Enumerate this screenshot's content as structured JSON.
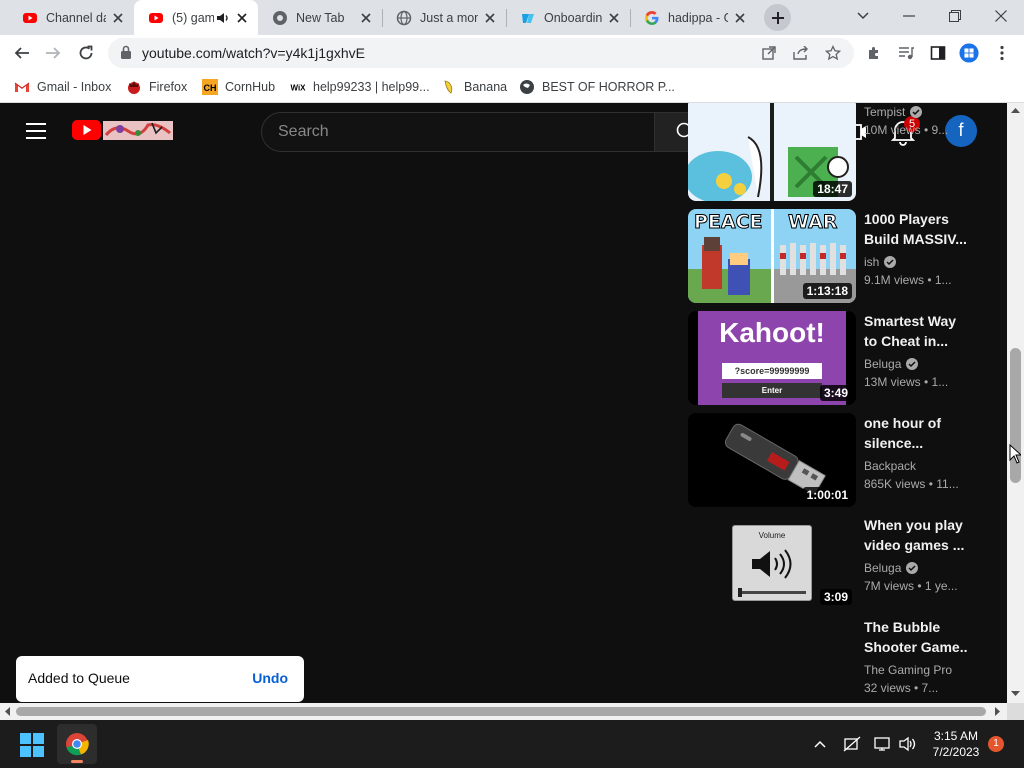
{
  "browser": {
    "tabs": [
      {
        "title": "Channel da",
        "favicon": "youtube-icon"
      },
      {
        "title": "(5) gam",
        "favicon": "youtube-icon",
        "active": true,
        "audio": true
      },
      {
        "title": "New Tab",
        "favicon": "chrome-icon"
      },
      {
        "title": "Just a mom",
        "favicon": "globe-icon"
      },
      {
        "title": "Onboardin",
        "favicon": "onboarding-icon"
      },
      {
        "title": "hadippa - G",
        "favicon": "google-icon"
      }
    ],
    "url": "youtube.com/watch?v=y4k1j1gxhvE"
  },
  "bookmarks": [
    {
      "label": "Gmail - Inbox",
      "icon": "gmail-icon"
    },
    {
      "label": "Firefox",
      "icon": "firefox-icon"
    },
    {
      "label": "CornHub",
      "icon": "cornhub-icon"
    },
    {
      "label": "help99233 | help99...",
      "icon": "wix-icon"
    },
    {
      "label": "Banana",
      "icon": "banana-icon"
    },
    {
      "label": "BEST OF HORROR P...",
      "icon": "globe-icon"
    }
  ],
  "youtube": {
    "search_placeholder": "Search",
    "notification_count": "5",
    "avatar_letter": "f",
    "related": [
      {
        "line1": "",
        "line2": "",
        "channel": "Tempist",
        "meta": "10M views • 9...",
        "duration": "18:47",
        "verified": true
      },
      {
        "line1": "1000 Players",
        "line2": "Build MASSIV...",
        "channel": "ish",
        "meta": "9.1M views • 1...",
        "duration": "1:13:18",
        "verified": true,
        "thumb_text_left": "PEACE",
        "thumb_text_right": "WAR"
      },
      {
        "line1": "Smartest Way",
        "line2": "to Cheat in...",
        "channel": "Beluga",
        "meta": "13M views • 1...",
        "duration": "3:49",
        "verified": true,
        "thumb_title": "Kahoot!",
        "thumb_score": "?score=99999999",
        "thumb_button": "Enter"
      },
      {
        "line1": "one hour of",
        "line2": "silence...",
        "channel": "Backpack",
        "meta": "865K views • 11...",
        "duration": "1:00:01",
        "verified": false
      },
      {
        "line1": "When you play",
        "line2": "video games ...",
        "channel": "Beluga",
        "meta": "7M views • 1 ye...",
        "duration": "3:09",
        "verified": true,
        "thumb_title": "Volume"
      },
      {
        "line1": "The Bubble",
        "line2": "Shooter Game...",
        "channel": "The Gaming Pro",
        "meta": "32 views • 7...",
        "duration": "",
        "verified": false
      }
    ],
    "toast": {
      "message": "Added to Queue",
      "action": "Undo"
    }
  },
  "taskbar": {
    "time": "3:15 AM",
    "date": "7/2/2023",
    "notification_count": "1"
  },
  "colors": {
    "youtube_red": "#ff0000",
    "accent_blue": "#065fd4",
    "dark_bg": "#0f0f0f"
  }
}
